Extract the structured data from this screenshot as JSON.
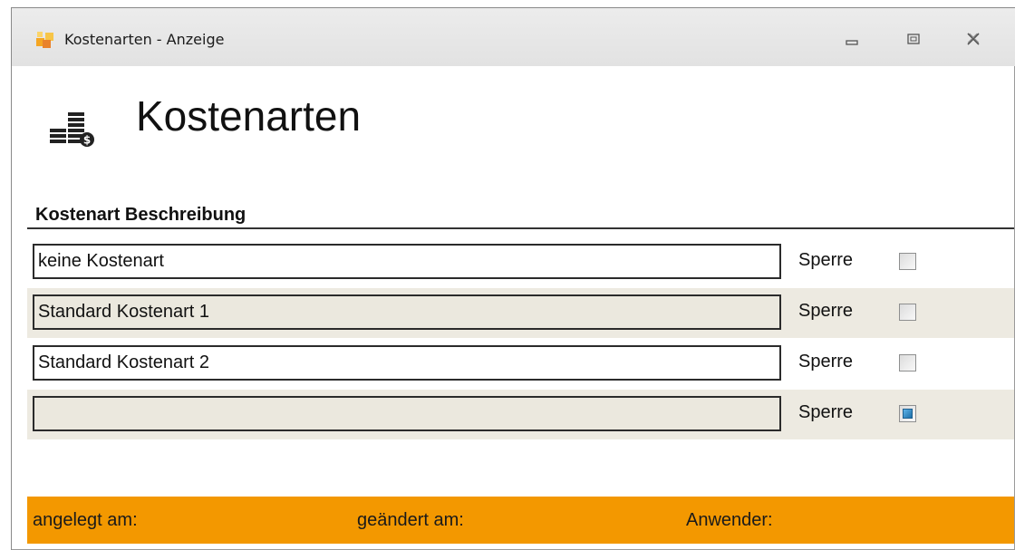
{
  "window": {
    "title": "Kostenarten - Anzeige",
    "icons": {
      "app": "app-icon",
      "minimize": "minimize-icon",
      "maximize": "maximize-icon",
      "close": "close-icon"
    }
  },
  "header": {
    "icon": "coins-icon",
    "title": "Kostenarten"
  },
  "table": {
    "column_header": "Kostenart Beschreibung",
    "rows": [
      {
        "description": "keine Kostenart",
        "lock_label": "Sperre",
        "locked": false
      },
      {
        "description": "Standard Kostenart 1",
        "lock_label": "Sperre",
        "locked": false
      },
      {
        "description": "Standard Kostenart 2",
        "lock_label": "Sperre",
        "locked": false
      },
      {
        "description": "",
        "lock_label": "Sperre",
        "locked": true
      }
    ]
  },
  "footer": {
    "created_label": "angelegt am:",
    "changed_label": "geändert am:",
    "user_label": "Anwender:"
  },
  "colors": {
    "footer_bg": "#f39800",
    "alt_row_bg": "#edeae1",
    "checkbox_checked": "#1c6ea8"
  }
}
